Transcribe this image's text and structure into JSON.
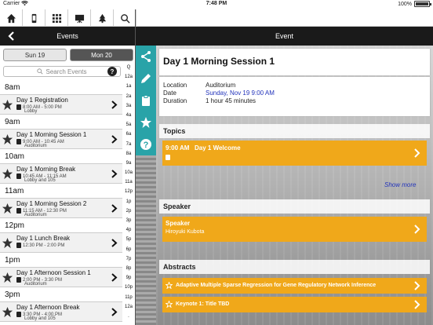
{
  "status_bar": {
    "carrier": "Carrier",
    "time": "7:48 PM",
    "battery": "100%"
  },
  "toolbar": {
    "icons": [
      "home-icon",
      "phone-icon",
      "grid-icon",
      "presentation-icon",
      "tree-icon",
      "search-icon"
    ]
  },
  "nav": {
    "left_title": "Events",
    "right_title": "Event"
  },
  "days": {
    "sun": "Sun 19",
    "mon": "Mon 20"
  },
  "search": {
    "placeholder": "Search Events",
    "help": "?"
  },
  "schedule": {
    "h8": "8am",
    "h9": "9am",
    "h10": "10am",
    "h11": "11am",
    "h12": "12pm",
    "h1": "1pm",
    "h3": "3pm",
    "e1": {
      "title": "Day 1 Registration",
      "time": "8:00 AM - 5:00 PM",
      "loc": "Lobby"
    },
    "e2": {
      "title": "Day 1 Morning Session 1",
      "time": "9:00 AM - 10:45 AM",
      "loc": "Auditorium"
    },
    "e3": {
      "title": "Day 1 Morning Break",
      "time": "10:45 AM - 11:15 AM",
      "loc": "Lobby and 105"
    },
    "e4": {
      "title": "Day 1 Morning Session 2",
      "time": "11:15 AM - 12:30 PM",
      "loc": "Auditorium"
    },
    "e5": {
      "title": "Day 1 Lunch Break",
      "time": "12:30 PM - 2:00 PM",
      "loc": ""
    },
    "e6": {
      "title": "Day 1 Afternoon Session 1",
      "time": "2:00 PM - 3:30 PM",
      "loc": "Auditorium"
    },
    "e7": {
      "title": "Day 1 Afternoon Break",
      "time": "3:30 PM - 4:00 PM",
      "loc": "Lobby and 105"
    }
  },
  "index_labels": [
    "Q",
    "12a",
    "1a",
    "2a",
    "3a",
    "4a",
    "5a",
    "6a",
    "7a",
    "8a",
    "9a",
    "10a",
    "11a",
    "12p",
    "1p",
    "2p",
    "3p",
    "4p",
    "5p",
    "6p",
    "7p",
    "8p",
    "9p",
    "10p",
    "11p",
    "12a",
    "."
  ],
  "event": {
    "title": "Day 1 Morning Session 1",
    "location_label": "Location",
    "location": "Auditorium",
    "date_label": "Date",
    "date": "Sunday, Nov 19 9:00 AM",
    "duration_label": "Duration",
    "duration": "1 hour 45 minutes"
  },
  "topics": {
    "label": "Topics",
    "item_time": "9:00 AM",
    "item_title": "Day 1 Welcome",
    "more": "Show more"
  },
  "speaker": {
    "label": "Speaker",
    "role": "Speaker",
    "name": "Hiroyuki Kubota"
  },
  "abstracts": {
    "label": "Abstracts",
    "a1": "Adaptive Multiple Sparse Regression for Gene Regulatory Network Inference",
    "a2": "Keynote 1: Title TBD"
  },
  "colors": {
    "accent_orange": "#f0a81a",
    "rail_teal": "#29a3a8",
    "link_blue": "#2233bb"
  }
}
